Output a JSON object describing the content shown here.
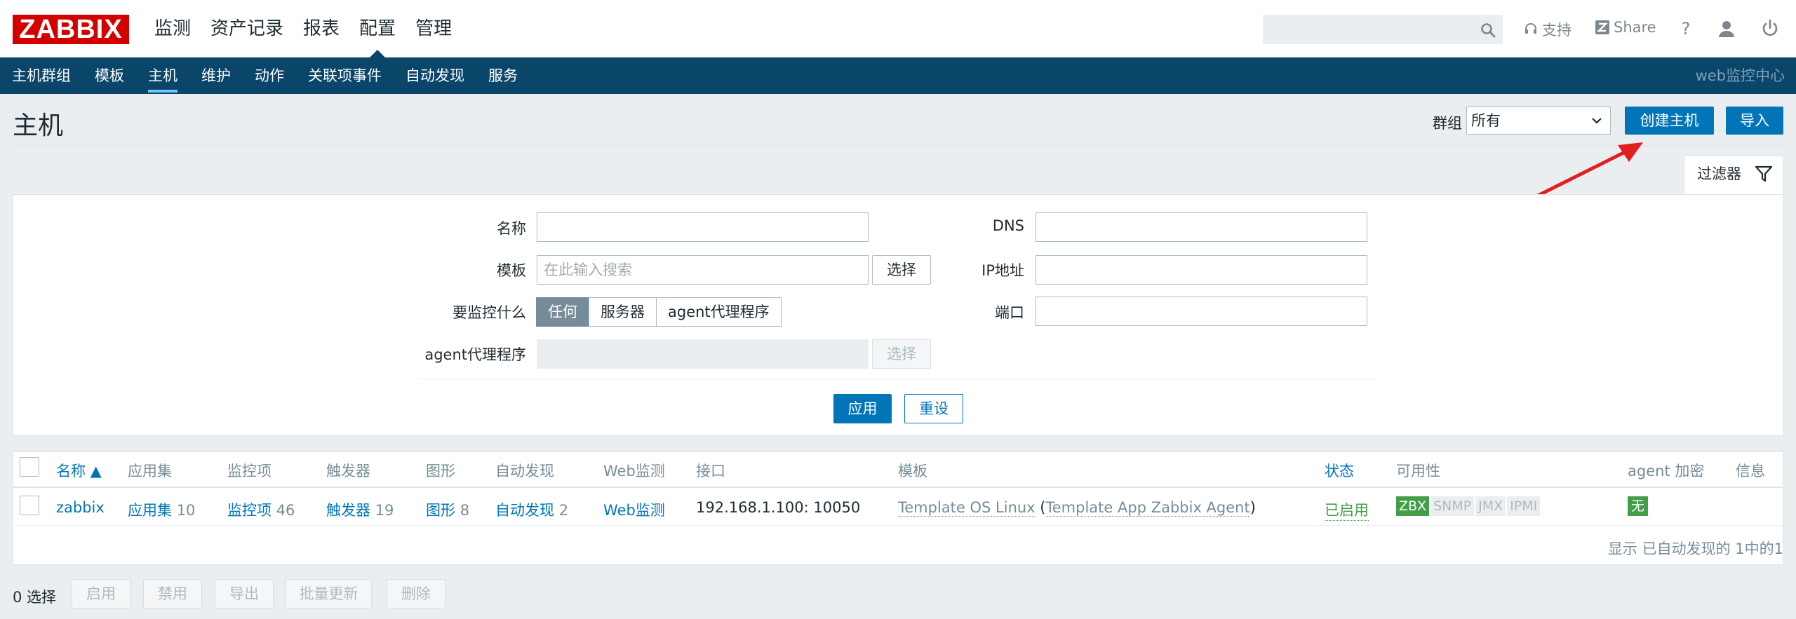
{
  "header": {
    "logo": "ZABBIX",
    "menu": [
      "监测",
      "资产记录",
      "报表",
      "配置",
      "管理"
    ],
    "selected_menu": "配置",
    "search_placeholder": "",
    "support_label": "支持",
    "share_label": "Share",
    "help_label": "?"
  },
  "subnav": {
    "items": [
      "主机群组",
      "模板",
      "主机",
      "维护",
      "动作",
      "关联项事件",
      "自动发现",
      "服务"
    ],
    "selected": "主机",
    "right_label": "web监控中心"
  },
  "page": {
    "title": "主机",
    "group_label": "群组",
    "group_value": "所有",
    "create_button": "创建主机",
    "import_button": "导入"
  },
  "filter": {
    "tab_label": "过滤器",
    "name_label": "名称",
    "name_value": "",
    "template_label": "模板",
    "template_placeholder": "在此输入搜索",
    "template_select": "选择",
    "monitored_by_label": "要监控什么",
    "monitored_by_options": [
      "任何",
      "服务器",
      "agent代理程序"
    ],
    "monitored_by_selected": "任何",
    "proxy_label": "agent代理程序",
    "proxy_select": "选择",
    "dns_label": "DNS",
    "dns_value": "",
    "ip_label": "IP地址",
    "ip_value": "",
    "port_label": "端口",
    "port_value": "",
    "apply_button": "应用",
    "reset_button": "重设"
  },
  "table": {
    "columns": {
      "name": "名称 ▲",
      "applications": "应用集",
      "items": "监控项",
      "triggers": "触发器",
      "graphs": "图形",
      "discovery": "自动发现",
      "web": "Web监测",
      "interface": "接口",
      "templates": "模板",
      "status": "状态",
      "availability": "可用性",
      "encryption": "agent 加密",
      "info": "信息"
    },
    "rows": [
      {
        "name": "zabbix",
        "applications_label": "应用集",
        "applications_count": "10",
        "items_label": "监控项",
        "items_count": "46",
        "triggers_label": "触发器",
        "triggers_count": "19",
        "graphs_label": "图形",
        "graphs_count": "8",
        "discovery_label": "自动发现",
        "discovery_count": "2",
        "web_label": "Web监测",
        "interface": "192.168.1.100: 10050",
        "template": "Template OS Linux",
        "template_open": " (",
        "template_parent": "Template App Zabbix Agent",
        "template_close": ")",
        "status": "已启用",
        "availability": [
          "ZBX",
          "SNMP",
          "JMX",
          "IPMI"
        ],
        "encryption": "无"
      }
    ],
    "footer": "显示 已自动发现的 1中的1"
  },
  "actions": {
    "selected_count": "0 选择",
    "buttons": [
      "启用",
      "禁用",
      "导出",
      "批量更新",
      "删除"
    ]
  },
  "colors": {
    "brand": "#d40000",
    "nav": "#0a466a",
    "primary": "#0275b8",
    "enabled": "#429e47",
    "annotation": "#e02020"
  }
}
